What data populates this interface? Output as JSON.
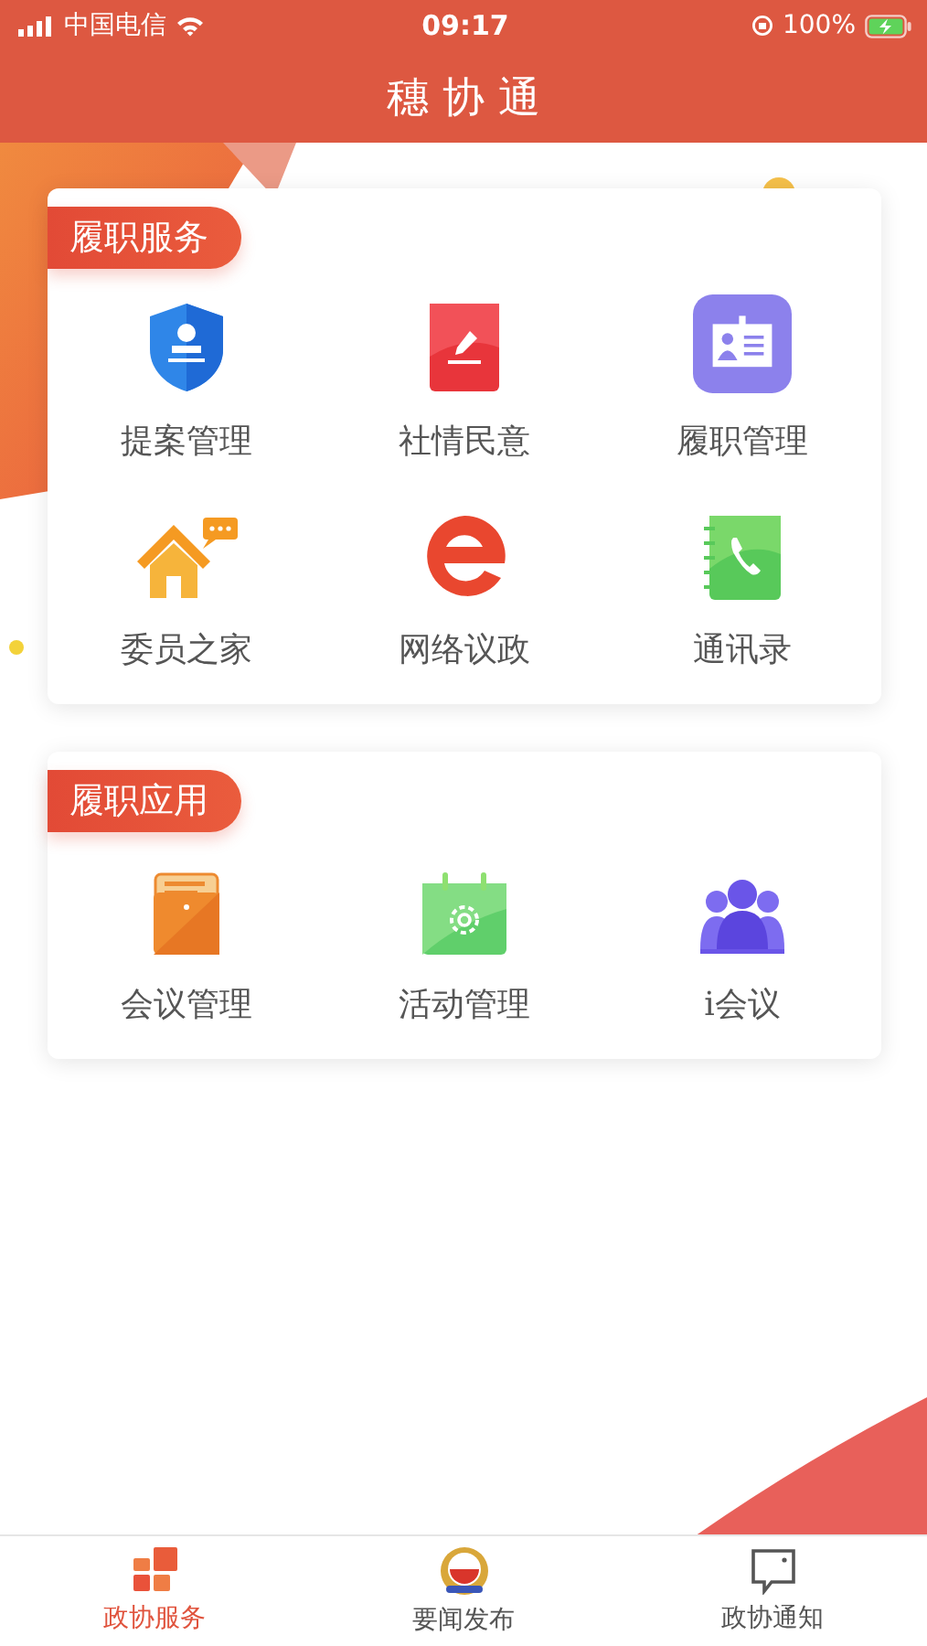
{
  "status_bar": {
    "carrier": "中国电信",
    "time": "09:17",
    "battery": "100%"
  },
  "header": {
    "title": "穗 协 通"
  },
  "sections": [
    {
      "title": "履职服务",
      "items": [
        {
          "label": "提案管理",
          "kind": "shield"
        },
        {
          "label": "社情民意",
          "kind": "notebook"
        },
        {
          "label": "履职管理",
          "kind": "badge"
        },
        {
          "label": "委员之家",
          "kind": "house"
        },
        {
          "label": "网络议政",
          "kind": "e"
        },
        {
          "label": "通讯录",
          "kind": "phonebook"
        }
      ]
    },
    {
      "title": "履职应用",
      "items": [
        {
          "label": "会议管理",
          "kind": "folder"
        },
        {
          "label": "活动管理",
          "kind": "calendar"
        },
        {
          "label": "i会议",
          "kind": "people"
        }
      ]
    }
  ],
  "tab_bar": [
    {
      "label": "政协服务",
      "kind": "grid",
      "selected": true
    },
    {
      "label": "要闻发布",
      "kind": "emblem",
      "selected": false
    },
    {
      "label": "政协通知",
      "kind": "chat",
      "selected": false
    }
  ]
}
